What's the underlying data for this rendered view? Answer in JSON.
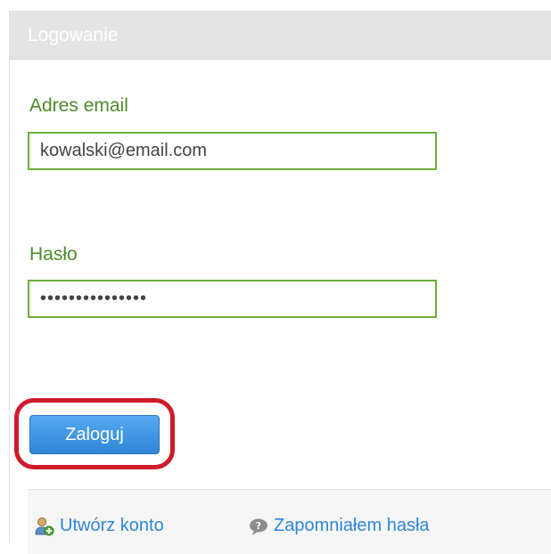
{
  "panel": {
    "title": "Logowanie"
  },
  "form": {
    "email_label": "Adres email",
    "email_value": "kowalski@email.com",
    "password_label": "Hasło",
    "password_value": "•••••••••••••••",
    "submit_label": "Zaloguj"
  },
  "footer": {
    "create_account": {
      "label": "Utwórz konto",
      "icon": "add-user-icon"
    },
    "forgot_password": {
      "label": "Zapomniałem hasła",
      "icon": "question-bubble-icon"
    }
  },
  "colors": {
    "label_green": "#4e8a2a",
    "input_border": "#6cae3a",
    "button_blue": "#2f86d6",
    "highlight_red": "#cf1b2b",
    "link_blue": "#2f86d6"
  }
}
